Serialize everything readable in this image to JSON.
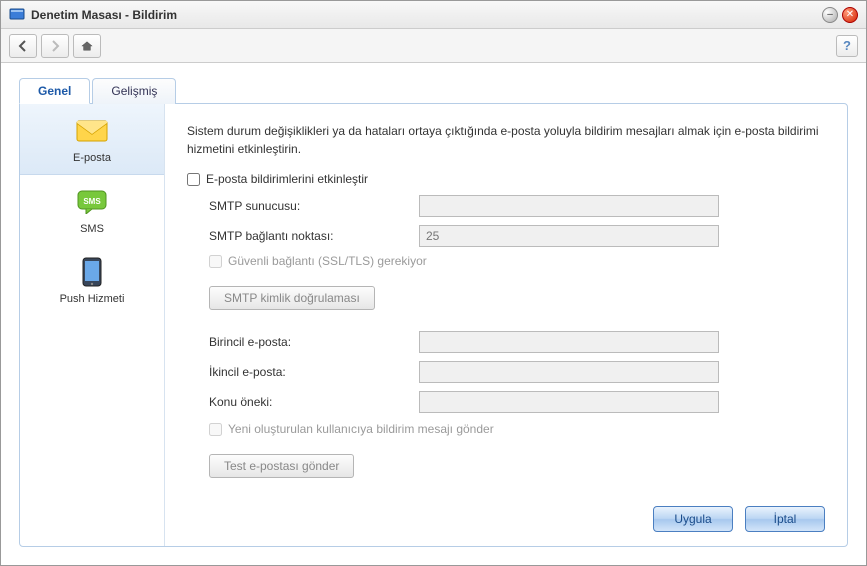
{
  "window": {
    "title": "Denetim Masası - Bildirim"
  },
  "tabs": {
    "general": "Genel",
    "advanced": "Gelişmiş"
  },
  "sidebar": {
    "email": "E-posta",
    "sms": "SMS",
    "push": "Push Hizmeti"
  },
  "main": {
    "intro": "Sistem durum değişiklikleri ya da hataları ortaya çıktığında e-posta yoluyla bildirim mesajları almak için e-posta bildirimi hizmetini etkinleştirin.",
    "enable_label": "E-posta bildirimlerini etkinleştir",
    "smtp_server_label": "SMTP sunucusu:",
    "smtp_server_value": "",
    "smtp_port_label": "SMTP bağlantı noktası:",
    "smtp_port_placeholder": "25",
    "ssl_label": "Güvenli bağlantı (SSL/TLS) gerekiyor",
    "smtp_auth_btn": "SMTP kimlik doğrulaması",
    "primary_email_label": "Birincil e-posta:",
    "primary_email_value": "",
    "secondary_email_label": "İkincil e-posta:",
    "secondary_email_value": "",
    "subject_prefix_label": "Konu öneki:",
    "subject_prefix_value": "",
    "send_new_user_label": "Yeni oluşturulan kullanıcıya bildirim mesajı gönder",
    "test_btn": "Test e-postası gönder"
  },
  "footer": {
    "apply": "Uygula",
    "cancel": "İptal"
  }
}
